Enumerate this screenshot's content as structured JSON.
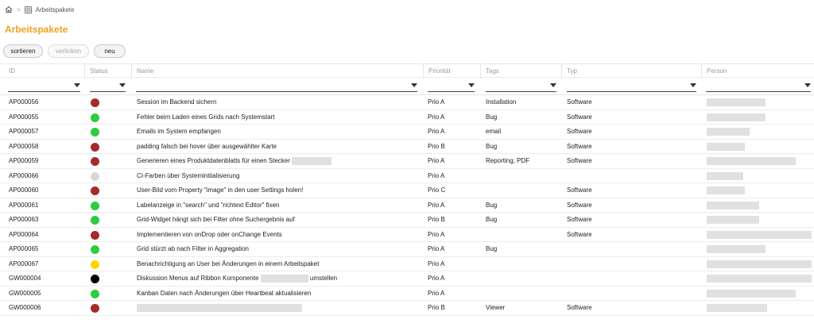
{
  "breadcrumb": {
    "current": "Arbeitspakete"
  },
  "page": {
    "title": "Arbeitspakete"
  },
  "toolbar": {
    "sortieren": "sortieren",
    "verlinken": "verlinken",
    "neu": "neu"
  },
  "columns": [
    "ID",
    "Status",
    "Name",
    "Priorität",
    "Tags",
    "Typ",
    "Person"
  ],
  "colors": {
    "red": "#a52a2a",
    "green": "#2ecc40",
    "grey": "#d8d8d8",
    "yellow": "#ffd500",
    "black": "#000000",
    "accent": "#f0a020"
  },
  "rows": [
    {
      "id": "AP000056",
      "status": "red",
      "name": "Session im Backend sichern",
      "prio": "Prio A",
      "tags": "Installation",
      "typ": "Software"
    },
    {
      "id": "AP000055",
      "status": "green",
      "name": "Fehler beim Laden eines Grids nach Systemstart",
      "prio": "Prio A",
      "tags": "Bug",
      "typ": "Software"
    },
    {
      "id": "AP000057",
      "status": "green",
      "name": "Emails im System empfangen",
      "prio": "Prio A",
      "tags": "email",
      "typ": "Software"
    },
    {
      "id": "AP000058",
      "status": "red",
      "name": "padding falsch bei hover über ausgewählter Karte",
      "prio": "Prio B",
      "tags": "Bug",
      "typ": "Software"
    },
    {
      "id": "AP000059",
      "status": "red",
      "name": "Generieren eines Produktdatenblatts für einen Stecker",
      "prio": "Prio A",
      "tags": "Reporting, PDF",
      "typ": "Software"
    },
    {
      "id": "AP000066",
      "status": "grey",
      "name": "CI-Farben über Systeminitialisierung",
      "prio": "Prio A",
      "tags": "",
      "typ": ""
    },
    {
      "id": "AP000060",
      "status": "red",
      "name": "User-Bild vom Property \"image\" in den user Settings holen!",
      "prio": "Prio C",
      "tags": "",
      "typ": "Software"
    },
    {
      "id": "AP000061",
      "status": "green",
      "name": "Labelanzeige in \"search\" und \"richtext Editor\" fixen",
      "prio": "Prio A",
      "tags": "Bug",
      "typ": "Software"
    },
    {
      "id": "AP000063",
      "status": "green",
      "name": "Grid-Widget hängt sich bei Filter ohne Suchergebnis auf",
      "prio": "Prio B",
      "tags": "Bug",
      "typ": "Software"
    },
    {
      "id": "AP000064",
      "status": "red",
      "name": "Implementieren von onDrop oder onChange Events",
      "prio": "Prio A",
      "tags": "",
      "typ": "Software"
    },
    {
      "id": "AP000065",
      "status": "green",
      "name": "Grid stürzt ab nach Filter in Aggregation",
      "prio": "Prio A",
      "tags": "Bug",
      "typ": ""
    },
    {
      "id": "AP000067",
      "status": "yellow",
      "name": "Benachrichtigung an User bei Änderungen in einem Arbeitspaket",
      "prio": "Prio A",
      "tags": "",
      "typ": ""
    },
    {
      "id": "GW000004",
      "status": "black",
      "name": "Diskussion Menus auf Ribbon Komponente",
      "name_suffix": "umstellen",
      "prio": "Prio A",
      "tags": "",
      "typ": ""
    },
    {
      "id": "GW000005",
      "status": "green",
      "name": "Kanban Daten nach Änderungen über Heartbeat aktualisieren",
      "prio": "Prio A",
      "tags": "",
      "typ": ""
    },
    {
      "id": "GW000006",
      "status": "red",
      "name": "",
      "prio": "Prio B",
      "tags": "Viewer",
      "typ": "Software"
    }
  ]
}
